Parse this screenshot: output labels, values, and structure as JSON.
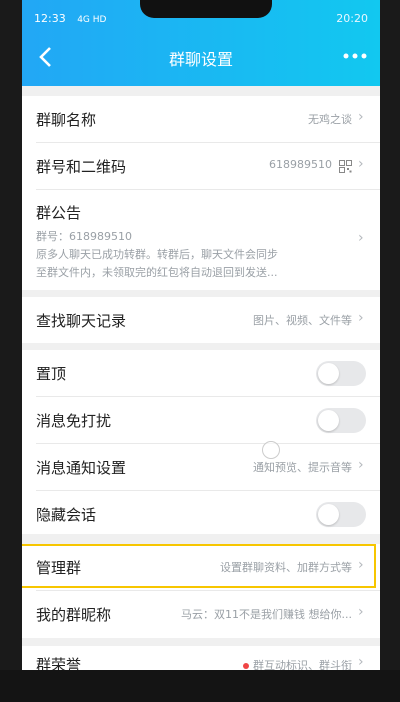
{
  "status_bar": {
    "time": "12:33",
    "signal": "4G HD",
    "right": "20:20"
  },
  "header": {
    "title": "群聊设置",
    "back_icon": "chevron-left-icon",
    "more_icon": "more-horizontal-icon"
  },
  "group_name": {
    "label": "群聊名称",
    "value": "无鸡之谈"
  },
  "group_number": {
    "label": "群号和二维码",
    "value": "618989510",
    "qr_icon": "qr-code-icon"
  },
  "announcement": {
    "label": "群公告",
    "number_line": "群号：618989510",
    "text_line1": "原多人聊天已成功转群。转群后，聊天文件会同步",
    "text_line2": "至群文件内，未领取完的红包将自动退回到发送..."
  },
  "search_history": {
    "label": "查找聊天记录",
    "value": "图片、视频、文件等"
  },
  "pin": {
    "label": "置顶",
    "on": false
  },
  "mute": {
    "label": "消息免打扰",
    "on": false
  },
  "notify": {
    "label": "消息通知设置",
    "value": "通知预览、提示音等"
  },
  "hide": {
    "label": "隐藏会话",
    "on": false
  },
  "manage": {
    "label": "管理群",
    "value": "设置群聊资料、加群方式等"
  },
  "nickname": {
    "label": "我的群昵称",
    "value": "马云：双11不是我们赚钱 想给你..."
  },
  "honor": {
    "label": "群荣誉",
    "value": "群互动标识、群斗衔"
  }
}
